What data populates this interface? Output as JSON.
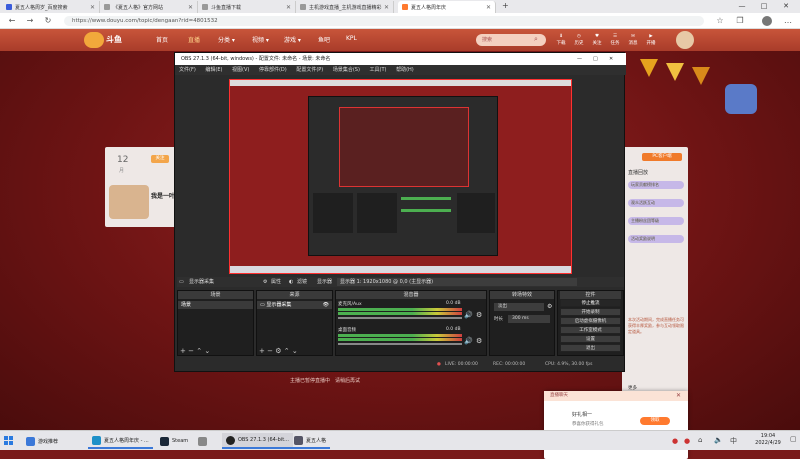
{
  "browser": {
    "tabs": [
      {
        "title": "夏五人格周岁_百度搜索",
        "icon": "baidu-icon"
      },
      {
        "title": "《夏五人格》官方网站",
        "icon": "page-icon"
      },
      {
        "title": "斗鱼直播下载",
        "icon": "page-icon"
      },
      {
        "title": "主机游戏直播_主机游戏直播精彩",
        "icon": "page-icon"
      },
      {
        "title": "夏五人格周年庆",
        "icon": "douyu-icon"
      }
    ],
    "new_tab": "+",
    "url": "https://www.douyu.com/topic/dengaan?rid=4801532",
    "window_controls": [
      "—",
      "□",
      "✕"
    ]
  },
  "site": {
    "logo": "斗鱼",
    "nav": [
      "首页",
      "直播",
      "分类 ▾",
      "视频 ▾",
      "游戏 ▾",
      "鱼吧",
      "KPL"
    ],
    "search_placeholder": "搜索",
    "header_icons": [
      "下载",
      "历史",
      "关注",
      "任务",
      "消息",
      "开播"
    ],
    "left_card": {
      "number": "12",
      "small": "月",
      "badge": "关注",
      "title": "我是一叶"
    },
    "right_card": {
      "btn": "PC客户端",
      "heading": "直播回放",
      "lines": [
        "玩家贡献榜排名",
        "观众活跃互动",
        "主播粉丝团等级",
        "活动奖励说明"
      ],
      "para": "本次活动期间，完成直播任务可获得丰厚奖励，参与互动领取限定道具。",
      "chip": "更多"
    },
    "bottom_notice": "主播已暂停直播中　请稍后再试",
    "chat_popup": {
      "header": "直播聊天",
      "line1": "好礼相一",
      "line2": "恭喜你获得礼包",
      "btn": "领取"
    }
  },
  "obs": {
    "title": "OBS 27.1.3 (64-bit, windows) - 配置文件: 未命名 - 场景: 未命名",
    "menu": [
      "文件(F)",
      "编辑(E)",
      "视图(V)",
      "停靠部件(D)",
      "配置文件(P)",
      "场景集合(S)",
      "工具(T)",
      "帮助(H)"
    ],
    "title_controls": [
      "—",
      "□",
      "✕"
    ],
    "source_bar": {
      "source": "显示器采集",
      "props": "属性",
      "filters": "滤镜",
      "display_label": "显示器",
      "display_value": "显示器 1: 1920x1080 @ 0,0 (主显示器)"
    },
    "docks": {
      "scenes": "场景",
      "sources": "来源",
      "mixer": "混音器",
      "transitions": "转场特效",
      "controls": "控件"
    },
    "scene_item": "场景",
    "source_item": "显示器采集",
    "mixer": [
      {
        "name": "麦克风/Aux",
        "db": "0.0 dB"
      },
      {
        "name": "桌面音频",
        "db": "0.0 dB"
      }
    ],
    "transition": {
      "type": "淡出",
      "duration_label": "时长",
      "duration": "300 ms"
    },
    "controls": [
      "停止推流",
      "开始录制",
      "启动虚拟摄像机",
      "工作室模式",
      "设置",
      "退出"
    ],
    "status": {
      "live": "LIVE: 00:00:00",
      "rec": "REC: 00:00:00",
      "cpu": "CPU: 4.9%, 30.00 fps"
    }
  },
  "taskbar": {
    "items": [
      {
        "label": "游戏推荐",
        "icon": "game-icon",
        "color": "#3b78d8"
      },
      {
        "label": "夏五人格周年庆 - ...",
        "icon": "edge-icon",
        "color": "#1e90c8"
      },
      {
        "label": "Steam",
        "icon": "steam-icon",
        "color": "#1b2838"
      },
      {
        "label": "",
        "icon": "doc-icon",
        "color": "#888"
      },
      {
        "label": "OBS 27.1.3 (64-bit...",
        "icon": "obs-icon",
        "color": "#222"
      },
      {
        "label": "夏五人格",
        "icon": "game2-icon",
        "color": "#556"
      }
    ],
    "time": "19:04",
    "date": "2022/4/29"
  }
}
